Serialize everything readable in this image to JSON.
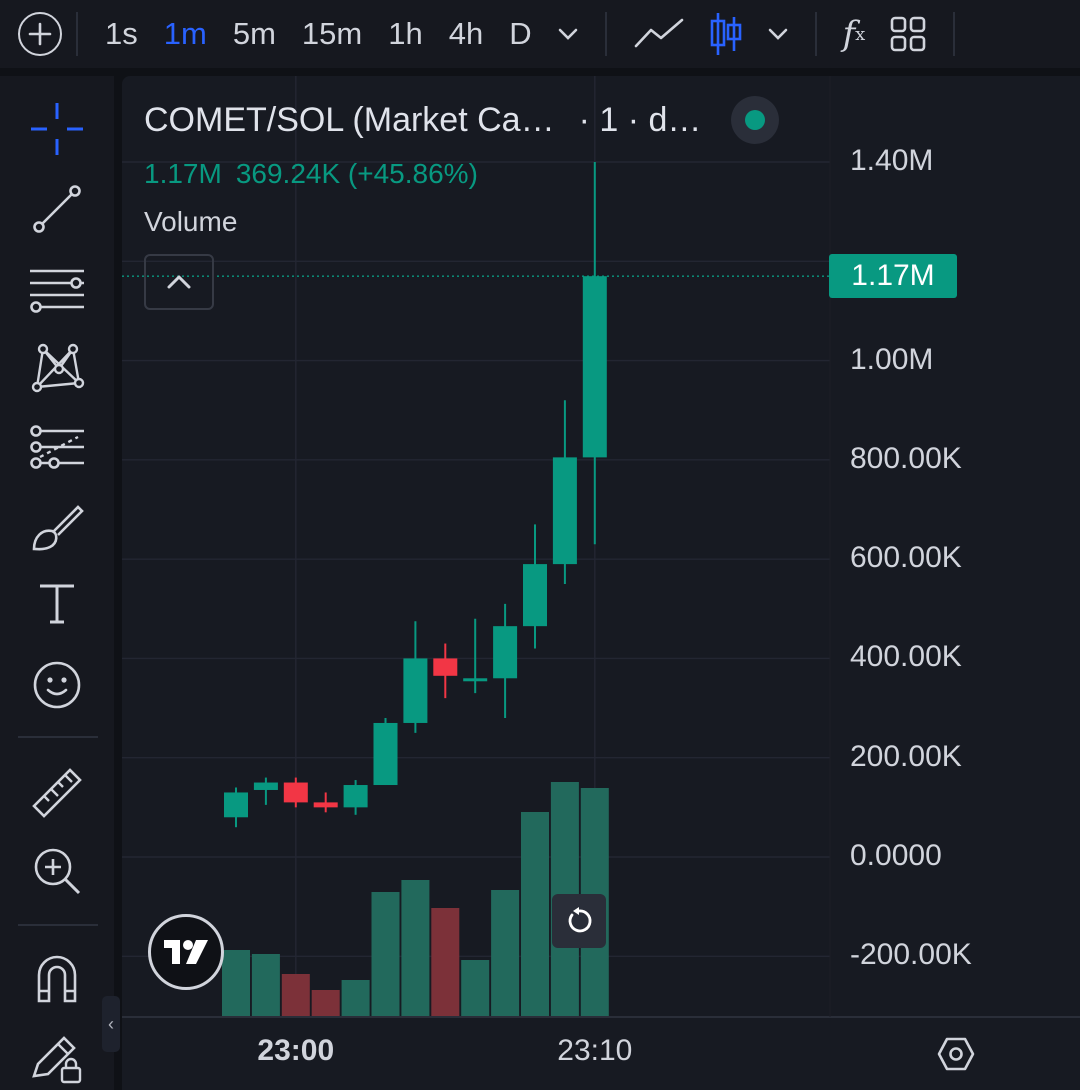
{
  "toolbar": {
    "intervals": [
      "1s",
      "1m",
      "5m",
      "15m",
      "1h",
      "4h",
      "D"
    ],
    "active_interval": "1m",
    "fx_label": "f",
    "fx_sub": "x",
    "accent_color": "#2962ff"
  },
  "legend": {
    "title": "COMET/SOL (Market Ca…",
    "meta": "· 1 · d…",
    "last": "1.17M",
    "change": "369.24K (+45.86%)",
    "volume_label": "Volume",
    "status_color": "#089981"
  },
  "price_axis": {
    "labels": [
      "1.40M",
      "1.00M",
      "800.00K",
      "600.00K",
      "400.00K",
      "200.00K",
      "0.0000",
      "-200.00K"
    ],
    "last_price_label": "1.17M"
  },
  "time_axis": {
    "labels": [
      "23:00",
      "23:10"
    ]
  },
  "colors": {
    "up": "#089981",
    "down": "#f23645",
    "volume_up": "#22695c",
    "volume_down": "#7c3139",
    "background": "#171a22"
  },
  "chart_data": {
    "type": "candlestick",
    "title": "COMET/SOL (Market Ca…",
    "x": [
      "22:59",
      "23:00",
      "23:01",
      "23:02",
      "23:03",
      "23:04",
      "23:05",
      "23:06",
      "23:07",
      "23:08",
      "23:09",
      "23:10",
      "23:11"
    ],
    "candles": [
      {
        "o": 80000,
        "h": 140000,
        "l": 60000,
        "c": 130000,
        "v": 3.3
      },
      {
        "o": 135000,
        "h": 160000,
        "l": 105000,
        "c": 150000,
        "v": 3.1
      },
      {
        "o": 150000,
        "h": 160000,
        "l": 100000,
        "c": 110000,
        "v": 2.1
      },
      {
        "o": 110000,
        "h": 130000,
        "l": 90000,
        "c": 100000,
        "v": 1.3
      },
      {
        "o": 100000,
        "h": 155000,
        "l": 85000,
        "c": 145000,
        "v": 1.8
      },
      {
        "o": 145000,
        "h": 280000,
        "l": 145000,
        "c": 270000,
        "v": 6.2
      },
      {
        "o": 270000,
        "h": 475000,
        "l": 250000,
        "c": 400000,
        "v": 6.8
      },
      {
        "o": 400000,
        "h": 430000,
        "l": 320000,
        "c": 365000,
        "v": 5.4
      },
      {
        "o": 360000,
        "h": 480000,
        "l": 330000,
        "c": 360000,
        "v": 2.8
      },
      {
        "o": 360000,
        "h": 510000,
        "l": 280000,
        "c": 465000,
        "v": 6.3
      },
      {
        "o": 465000,
        "h": 670000,
        "l": 420000,
        "c": 590000,
        "v": 10.2
      },
      {
        "o": 590000,
        "h": 920000,
        "l": 550000,
        "c": 805000,
        "v": 11.7
      },
      {
        "o": 805000,
        "h": 1400000,
        "l": 630000,
        "c": 1170000,
        "v": 11.4
      }
    ],
    "ylim": [
      -320000,
      1400000
    ],
    "last_price": 1170000,
    "grid": true
  }
}
